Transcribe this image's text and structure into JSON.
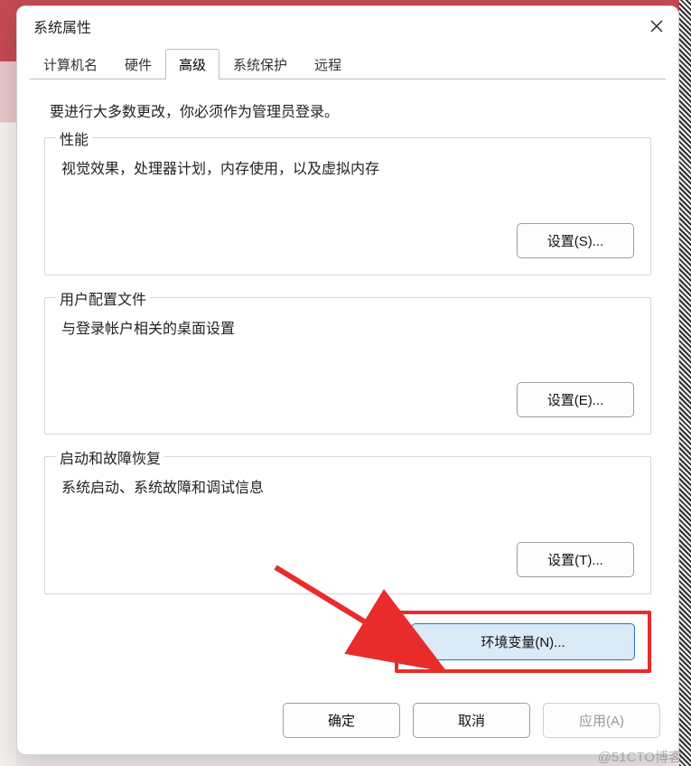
{
  "dialog": {
    "title": "系统属性"
  },
  "tabs": {
    "items": [
      {
        "label": "计算机名"
      },
      {
        "label": "硬件"
      },
      {
        "label": "高级"
      },
      {
        "label": "系统保护"
      },
      {
        "label": "远程"
      }
    ],
    "active_index": 2
  },
  "panel": {
    "admin_note": "要进行大多数更改，你必须作为管理员登录。",
    "performance": {
      "legend": "性能",
      "desc": "视觉效果，处理器计划，内存使用，以及虚拟内存",
      "button": "设置(S)..."
    },
    "profile": {
      "legend": "用户配置文件",
      "desc": "与登录帐户相关的桌面设置",
      "button": "设置(E)..."
    },
    "startup": {
      "legend": "启动和故障恢复",
      "desc": "系统启动、系统故障和调试信息",
      "button": "设置(T)..."
    },
    "env_button": "环境变量(N)..."
  },
  "footer": {
    "ok": "确定",
    "cancel": "取消",
    "apply": "应用(A)"
  },
  "watermark": "@51CTO博客",
  "annotation": {
    "highlight_color": "#e82b2b"
  }
}
